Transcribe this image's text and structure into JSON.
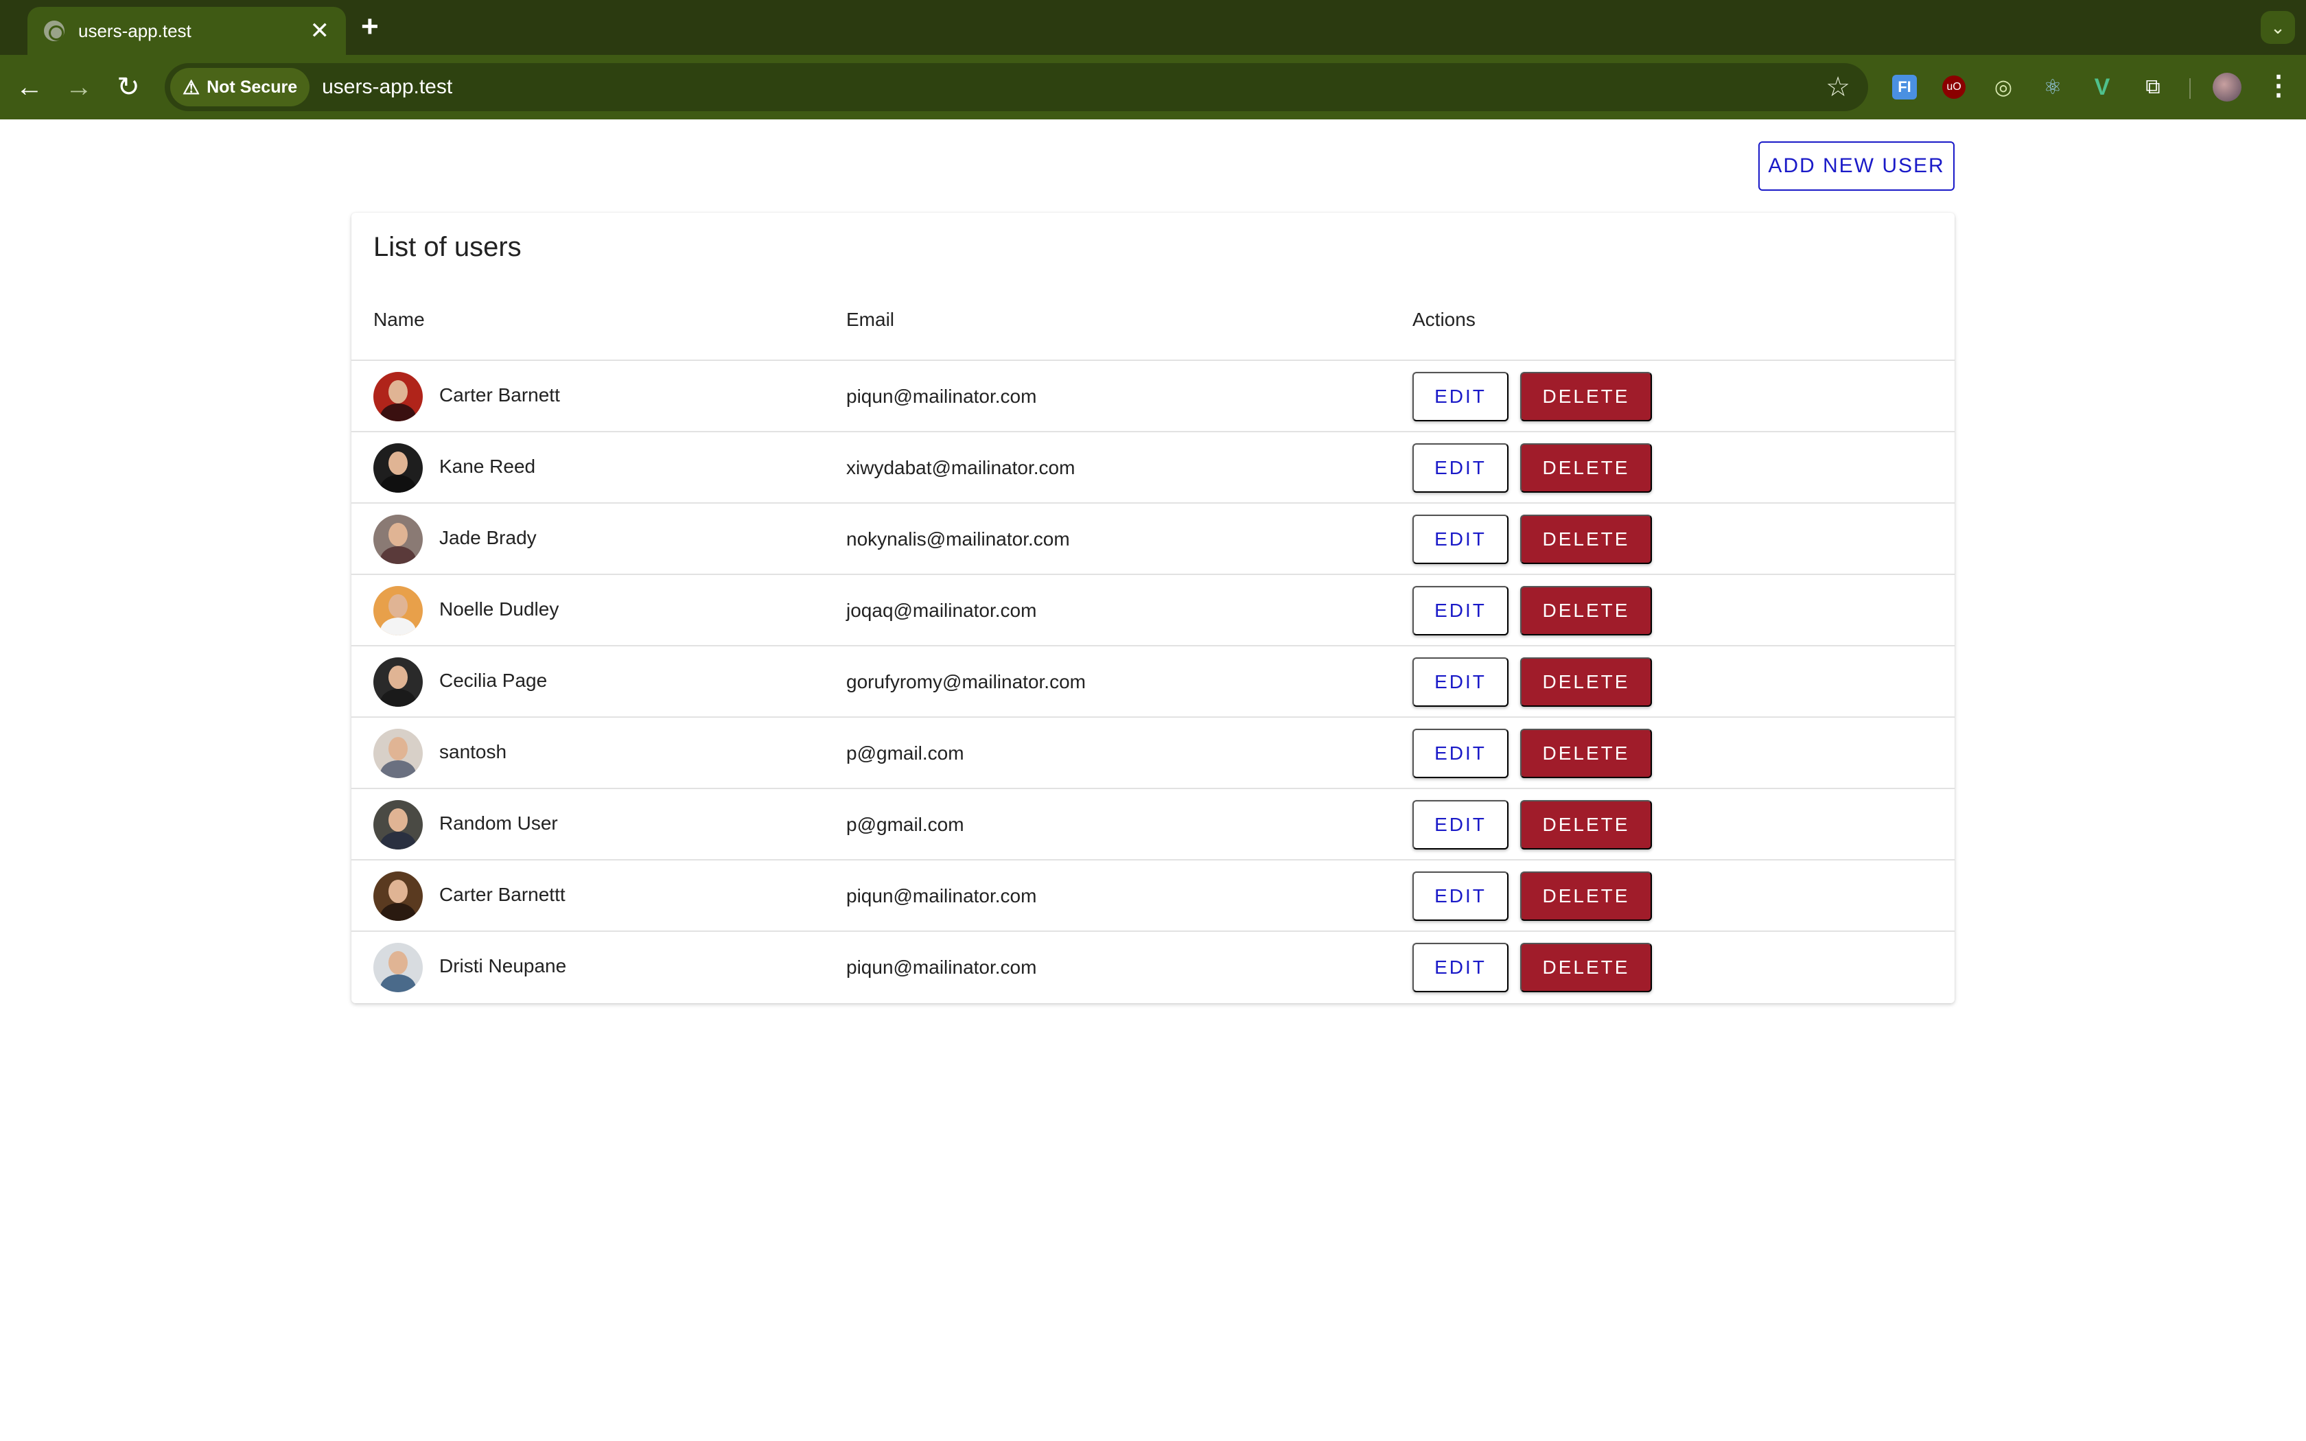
{
  "browser": {
    "tab_title": "users-app.test",
    "close_glyph": "✕",
    "new_tab_glyph": "+",
    "tab_menu_glyph": "⌄",
    "security_label": "Not Secure",
    "url": "users-app.test",
    "extensions": [
      "fi-extension-icon",
      "ublock-icon",
      "target-icon",
      "react-devtools-icon",
      "vue-devtools-icon",
      "puzzle-extensions-icon"
    ]
  },
  "page": {
    "add_button_label": "ADD NEW USER",
    "card_title": "List of users",
    "columns": {
      "name": "Name",
      "email": "Email",
      "actions": "Actions"
    },
    "edit_label": "EDIT",
    "delete_label": "DELETE"
  },
  "users": [
    {
      "name": "Carter Barnett",
      "email": "piqun@mailinator.com",
      "avatar_bg": "#b0241a",
      "avatar_body": "#3a1010"
    },
    {
      "name": "Kane Reed",
      "email": "xiwydabat@mailinator.com",
      "avatar_bg": "#1e1e1e",
      "avatar_body": "#101010"
    },
    {
      "name": "Jade Brady",
      "email": "nokynalis@mailinator.com",
      "avatar_bg": "#8a7a74",
      "avatar_body": "#5a3a3a"
    },
    {
      "name": "Noelle Dudley",
      "email": "joqaq@mailinator.com",
      "avatar_bg": "#e8a04a",
      "avatar_body": "#f4f4f4"
    },
    {
      "name": "Cecilia Page",
      "email": "gorufyromy@mailinator.com",
      "avatar_bg": "#2a2a2a",
      "avatar_body": "#1a1a1a"
    },
    {
      "name": "santosh",
      "email": "p@gmail.com",
      "avatar_bg": "#d8d0c8",
      "avatar_body": "#6a7080"
    },
    {
      "name": "Random User",
      "email": "p@gmail.com",
      "avatar_bg": "#4a4a44",
      "avatar_body": "#2a3040"
    },
    {
      "name": "Carter Barnettt",
      "email": "piqun@mailinator.com",
      "avatar_bg": "#5a3a20",
      "avatar_body": "#2a1a10"
    },
    {
      "name": "Dristi Neupane",
      "email": "piqun@mailinator.com",
      "avatar_bg": "#d8dce0",
      "avatar_body": "#4a6a8a"
    }
  ]
}
